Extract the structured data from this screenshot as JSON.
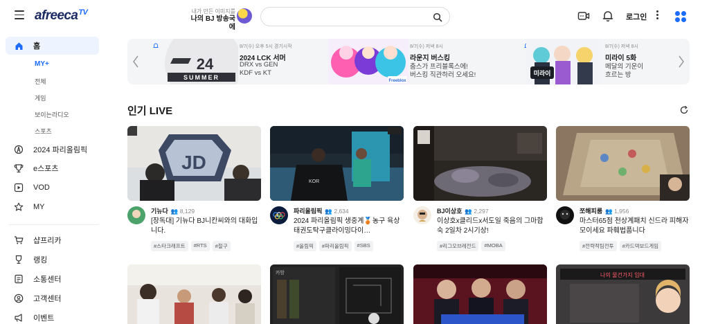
{
  "header": {
    "logo_text": "afreeca",
    "logo_tv": "TV",
    "promo_small": "내가 만든 이미지를",
    "promo_big": "나의 BJ 방송국에",
    "search_placeholder": "",
    "login_label": "로그인",
    "icons": [
      "menu-icon",
      "search-icon",
      "broadcast-icon",
      "bell-icon",
      "more-vertical-icon",
      "apps-icon"
    ]
  },
  "sidebar": {
    "home": "홈",
    "sub": [
      "MY+",
      "전체",
      "게임",
      "보이는라디오",
      "스포츠"
    ],
    "items_top": [
      "2024 파리올림픽",
      "e스포츠",
      "VOD",
      "MY"
    ],
    "items_bottom": [
      "샵프리카",
      "랭킹",
      "소통센터",
      "고객센터",
      "이벤트"
    ]
  },
  "banner": [
    {
      "time": "8/7(수) 오후 5시 경기시작",
      "title": "2024 LCK 서머",
      "line1": "DRX vs GEN",
      "line2": "KDF vs KT",
      "img_text1": "24",
      "img_text2": "SUMMER"
    },
    {
      "time": "8/7(수) 저녁 8시",
      "title": "라운지 버스킹",
      "line1": "춤스가 프리블록스에!",
      "line2": "버스킹 직관하러 오세요!",
      "img_text1": "Freeblox"
    },
    {
      "time": "8/7(수) 저녁 8시",
      "title": "미라이 5화",
      "line1": "메달의 기운이",
      "line2": "흐르는 방",
      "img_text1": "미라이"
    }
  ],
  "section": {
    "title": "인기 LIVE"
  },
  "cards": [
    {
      "name": "기뉴다",
      "viewers": "8,129",
      "title": "[장독대] 기뉴다 BJ니칸씨와의 대화입니다.",
      "tags": [
        "#스타크래프트",
        "#RTS",
        "#철구"
      ]
    },
    {
      "name": "파리올림픽",
      "viewers": "2,634",
      "title": "2024 파리올림픽 생중계🥉농구 육상태권도탁구클라이밍다이…",
      "tags": [
        "#올림픽",
        "#파리올림픽",
        "#SBS"
      ]
    },
    {
      "name": "BJ이상호",
      "viewers": "2,297",
      "title": "이상호x클리드x서도일 죽음의 그마합숙 2일차 2시기상!",
      "tags": [
        "#리그오브레전드",
        "#MOBA"
      ]
    },
    {
      "name": "쪼해피룸",
      "viewers": "1,956",
      "title": "마스터65점 천상계패치 신드라 피해자 모이세요 파훼법풉니다",
      "tags": [
        "#전략적팀전투",
        "#카드덱보드게임"
      ]
    }
  ],
  "row2_text": {
    "card6_label": "카방",
    "card8_banner": "나의 물건가지 임대"
  },
  "colors": {
    "accent": "#1d6cff",
    "logo": "#1b2a63"
  }
}
